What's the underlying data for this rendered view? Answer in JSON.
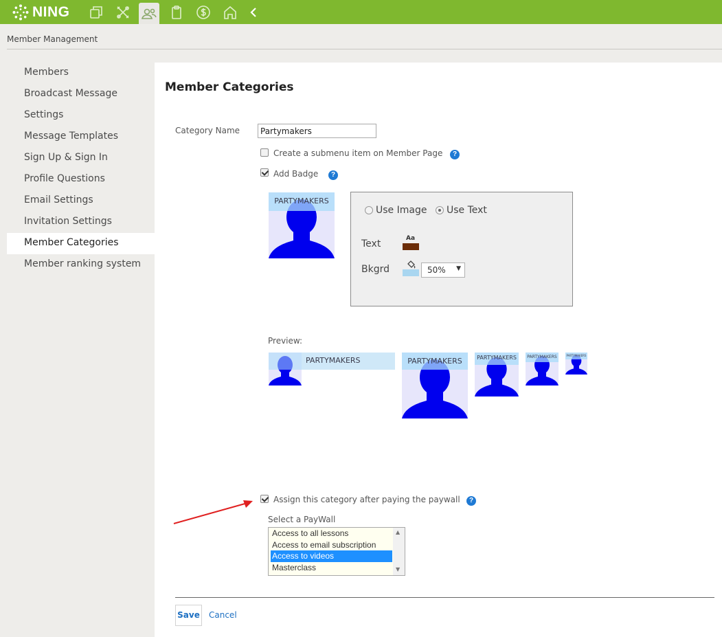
{
  "app": {
    "logo_text": "NING"
  },
  "toolbar": {
    "icons": [
      "pages-icon",
      "tools-icon",
      "members-icon",
      "clipboard-icon",
      "dollar-icon",
      "home-icon",
      "back-chevron-icon"
    ],
    "active": "members-icon"
  },
  "breadcrumb": {
    "label": "Member Management"
  },
  "sidebar": {
    "items": [
      {
        "label": "Members"
      },
      {
        "label": "Broadcast Message"
      },
      {
        "label": "Settings"
      },
      {
        "label": "Message Templates"
      },
      {
        "label": "Sign Up & Sign In"
      },
      {
        "label": "Profile Questions"
      },
      {
        "label": "Email Settings"
      },
      {
        "label": "Invitation Settings"
      },
      {
        "label": "Member Categories",
        "active": true
      },
      {
        "label": "Member ranking system"
      }
    ]
  },
  "main": {
    "title": "Member Categories",
    "category_name_label": "Category Name",
    "category_name_value": "Partymakers",
    "submenu_checkbox": {
      "label": "Create a submenu item on Member Page",
      "checked": false
    },
    "badge_checkbox": {
      "label": "Add Badge",
      "checked": true
    },
    "help_glyph": "?",
    "badge_text": "PARTYMAKERS",
    "badge_options": {
      "use_image": "Use Image",
      "use_text": "Use Text",
      "selected": "Use Text",
      "text_label": "Text",
      "text_color_icon": "Aa",
      "bg_label": "Bkgrd",
      "opacity": "50%",
      "colors": {
        "text": "#6b2c07",
        "background": "#a9d6f0"
      }
    },
    "preview_label": "Preview:",
    "paywall_checkbox": {
      "label": "Assign this category after paying the paywall",
      "checked": true
    },
    "paywall_select_label": "Select a PayWall",
    "paywall_options": [
      {
        "label": "Access to all lessons",
        "selected": false
      },
      {
        "label": "Access to email subscription",
        "selected": false
      },
      {
        "label": "Access to videos",
        "selected": true
      },
      {
        "label": "Masterclass",
        "selected": false
      }
    ],
    "save_label": "Save",
    "cancel_label": "Cancel"
  },
  "colors": {
    "topbar": "#7fb82f",
    "link": "#1c6fc2",
    "avatar": "#0000ee",
    "annotation_arrow": "#e02020"
  }
}
